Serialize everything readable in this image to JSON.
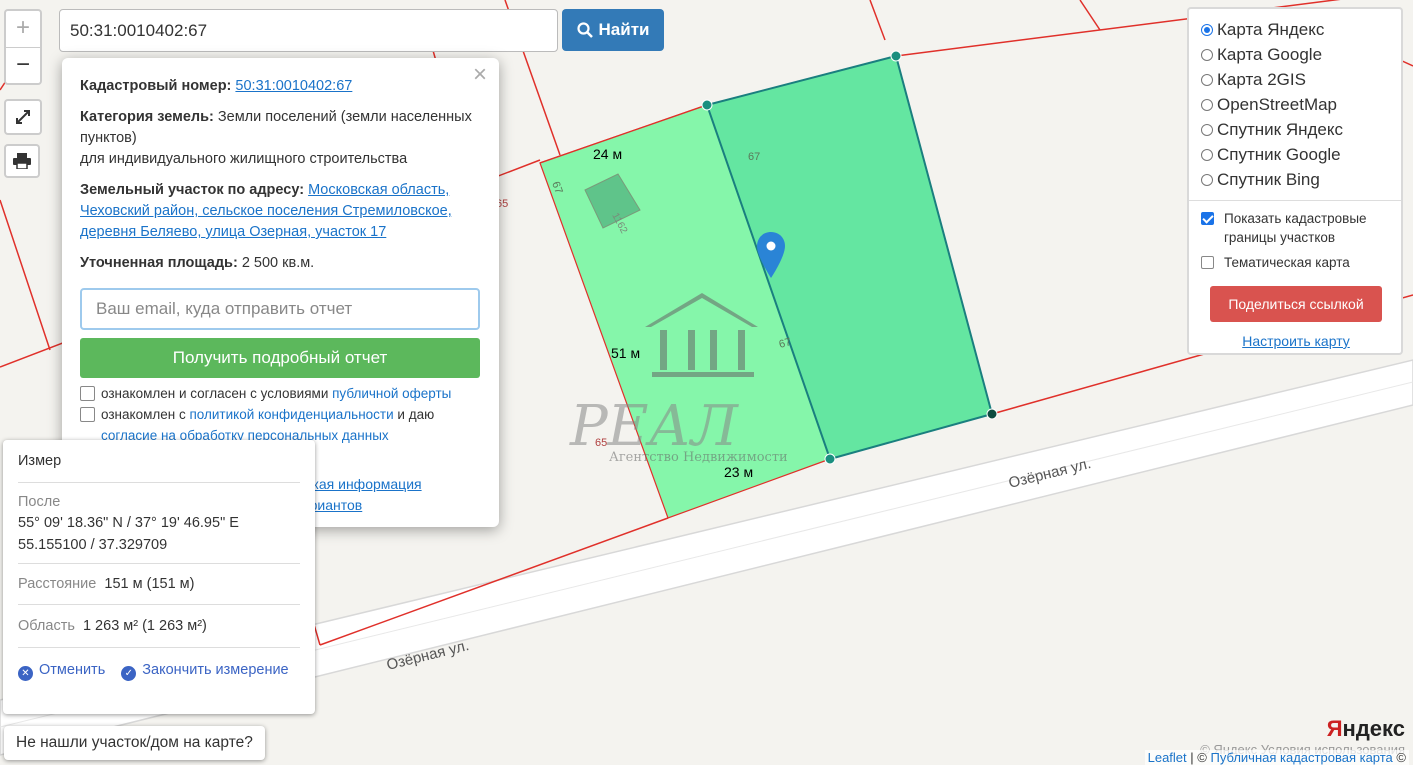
{
  "search": {
    "value": "50:31:0010402:67",
    "button_label": "Найти"
  },
  "zoom": {
    "in": "+",
    "out": "−"
  },
  "popup": {
    "close": "×",
    "cad_label": "Кадастровый номер:",
    "cad_value": "50:31:0010402:67",
    "cat_label": "Категория земель:",
    "cat_value": "Земли поселений (земли населенных пунктов)",
    "cat_use": "для индивидуального жилищного строительства",
    "addr_label": "Земельный участок по адресу:",
    "addr_value": "Московская область, Чеховский район, сельское поселения Стремиловское, деревня Беляево, улица Озерная, участок 17",
    "area_label": "Уточненная площадь:",
    "area_value": "2 500 кв.м.",
    "email_placeholder": "Ваш email, куда отправить отчет",
    "report_button": "Получить подробный отчет",
    "check1_text": "ознакомлен и согласен с условиями",
    "check1_link": "публичной оферты",
    "check2_text": "ознакомлен с",
    "check2_link": "политикой конфиденциальности",
    "check2_text2": "и даю",
    "check2_link2": "согласие на обработку персональных данных",
    "link_details": "Детали отчета и юридическая информация",
    "link_manual": "Ручной выбор вариантов"
  },
  "layers": {
    "options": [
      {
        "label": "Карта Яндекс",
        "selected": true
      },
      {
        "label": "Карта Google",
        "selected": false
      },
      {
        "label": "Карта 2GIS",
        "selected": false
      },
      {
        "label": "OpenStreetMap",
        "selected": false
      },
      {
        "label": "Спутник Яндекс",
        "selected": false
      },
      {
        "label": "Спутник Google",
        "selected": false
      },
      {
        "label": "Спутник Bing",
        "selected": false
      }
    ],
    "show_borders": "Показать кадастровые границы участков",
    "show_borders_checked": true,
    "thematic": "Тематическая карта",
    "thematic_checked": false,
    "share_button": "Поделиться ссылкой",
    "configure_link": "Настроить карту"
  },
  "measure": {
    "title": "Измер",
    "last_label": "После",
    "coord_dms": "55° 09' 18.36\" N / 37° 19' 46.95\" E",
    "coord_dec": "55.155100 / 37.329709",
    "distance_label": "Расстояние",
    "distance_value": "151 м (151 м)",
    "area_label": "Область",
    "area_value": "1 263 м² (1 263 м²)",
    "cancel": "Отменить",
    "finish": "Закончить измерение"
  },
  "not_found": "Не нашли участок/дом на карте?",
  "map": {
    "street_upper": "Озёрная ул.",
    "street_lower": "Озёрная ул.",
    "dim_top": "24 м",
    "dim_side": "51 м",
    "dim_bottom": "23 м",
    "parcel_labels": [
      "67",
      "67",
      "67",
      "65",
      "65",
      "1162"
    ],
    "watermark_name": "РЕАЛ",
    "watermark_sub": "Агентство Недвижимости",
    "colors": {
      "parcel_fill": "#7ef5a5",
      "measure_fill": "#5ee3a0",
      "border": "#e0302a",
      "accent": "#337ab7"
    }
  },
  "attribution": {
    "leaflet": "Leaflet",
    "sep": "| ©",
    "pkk": "Публичная кадастровая карта",
    "tail": "©",
    "yandex_logo_a": "Я",
    "yandex_logo_b": "ндекс",
    "terms": "© Яндекс  Условия использования"
  }
}
